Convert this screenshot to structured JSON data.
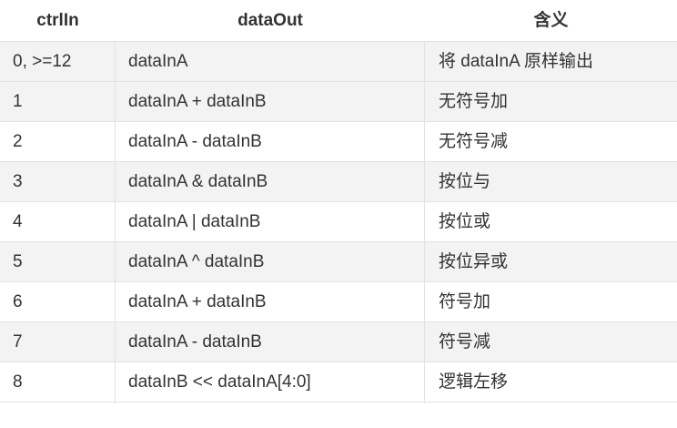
{
  "header": {
    "col1": "ctrlIn",
    "col2": "dataOut",
    "col3": "含义"
  },
  "rows": [
    {
      "ctrl": "0, >=12",
      "out": "dataInA",
      "meaning": "将 dataInA 原样输出"
    },
    {
      "ctrl": "1",
      "out": "dataInA + dataInB",
      "meaning": "无符号加"
    },
    {
      "ctrl": "2",
      "out": "dataInA - dataInB",
      "meaning": "无符号减"
    },
    {
      "ctrl": "3",
      "out": "dataInA & dataInB",
      "meaning": "按位与"
    },
    {
      "ctrl": "4",
      "out": "dataInA | dataInB",
      "meaning": "按位或"
    },
    {
      "ctrl": "5",
      "out": "dataInA ^ dataInB",
      "meaning": "按位异或"
    },
    {
      "ctrl": "6",
      "out": "dataInA + dataInB",
      "meaning": "符号加"
    },
    {
      "ctrl": "7",
      "out": "dataInA - dataInB",
      "meaning": "符号减"
    },
    {
      "ctrl": "8",
      "out": "dataInB << dataInA[4:0]",
      "meaning": "逻辑左移"
    }
  ]
}
